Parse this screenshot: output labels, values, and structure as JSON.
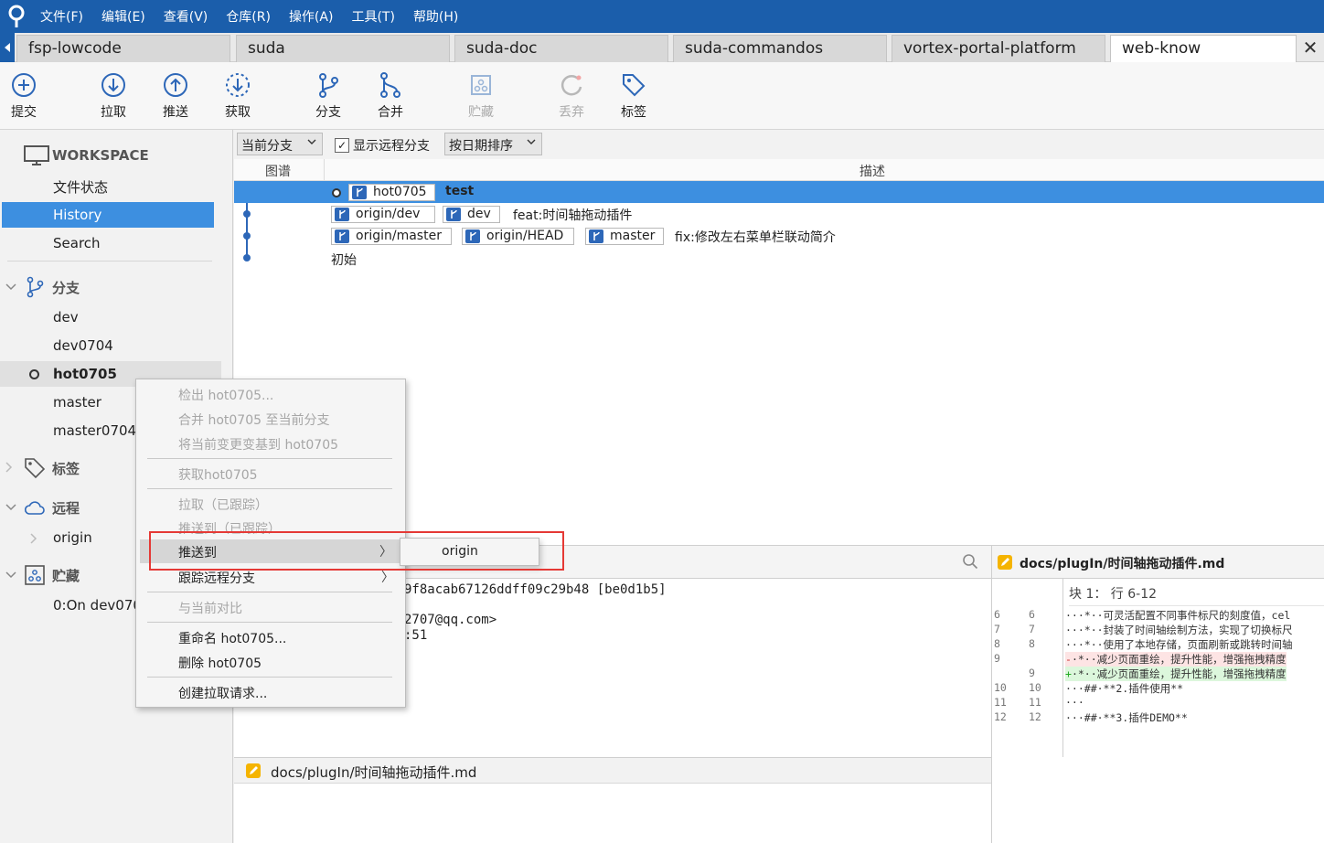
{
  "menu": [
    "文件(F)",
    "编辑(E)",
    "查看(V)",
    "仓库(R)",
    "操作(A)",
    "工具(T)",
    "帮助(H)"
  ],
  "tabs": [
    "fsp-lowcode",
    "suda",
    "suda-doc",
    "suda-commandos",
    "vortex-portal-platform",
    "web-know"
  ],
  "tab_close": "✕",
  "toolbar": {
    "commit": "提交",
    "pull": "拉取",
    "push": "推送",
    "fetch": "获取",
    "branch": "分支",
    "merge": "合并",
    "stash": "贮藏",
    "discard": "丢弃",
    "tag": "标签"
  },
  "sidebar": {
    "workspace": "WORKSPACE",
    "file_status": "文件状态",
    "history": "History",
    "search": "Search",
    "branches_label": "分支",
    "branches": [
      "dev",
      "dev0704",
      "hot0705",
      "master",
      "master0704"
    ],
    "tags_label": "标签",
    "remotes_label": "远程",
    "remotes": [
      "origin"
    ],
    "stashes_label": "贮藏",
    "stashes": [
      "0:On dev070"
    ]
  },
  "filter": {
    "branch_mode": "当前分支",
    "show_remote": "显示远程分支",
    "show_remote_checked": "✓",
    "sort": "按日期排序"
  },
  "grid_header": {
    "graph": "图谱",
    "description": "描述"
  },
  "commits": [
    {
      "badges": [
        "hot0705"
      ],
      "message": "test"
    },
    {
      "badges": [
        "origin/dev",
        "dev"
      ],
      "message": "feat:时间轴拖动插件"
    },
    {
      "badges": [
        "origin/master",
        "origin/HEAD",
        "master"
      ],
      "message": "fix:修改左右菜单栏联动简介"
    },
    {
      "badges": [],
      "message": "初始"
    }
  ],
  "details": {
    "hash": "9f8acab67126ddff09c29b48 [be0d1b5]",
    "email": "2707@qq.com>",
    "time": ":51"
  },
  "filelist": {
    "file": "docs/plugIn/时间轴拖动插件.md"
  },
  "diff": {
    "title": "docs/plugIn/时间轴拖动插件.md",
    "hunk": "块 1： 行 6-12",
    "lines": [
      {
        "n1": "6",
        "n2": "6",
        "type": "ctx",
        "sign": "",
        "text": "···*··可灵活配置不同事件标尺的刻度值，cel"
      },
      {
        "n1": "7",
        "n2": "7",
        "type": "ctx",
        "sign": "",
        "text": "···*··封装了时间轴绘制方法，实现了切换标尺"
      },
      {
        "n1": "8",
        "n2": "8",
        "type": "ctx",
        "sign": "",
        "text": "···*··使用了本地存储，页面刷新或跳转时间轴"
      },
      {
        "n1": "9",
        "n2": "",
        "type": "del",
        "sign": "-",
        "text": "·*··减少页面重绘，提升性能，增强拖拽精度"
      },
      {
        "n1": "",
        "n2": "9",
        "type": "add",
        "sign": "+",
        "text": "·*··减少页面重绘，提升性能，增强拖拽精度"
      },
      {
        "n1": "10",
        "n2": "10",
        "type": "ctx",
        "sign": "",
        "text": "···##·**2.插件使用**"
      },
      {
        "n1": "11",
        "n2": "11",
        "type": "ctx",
        "sign": "",
        "text": "···"
      },
      {
        "n1": "12",
        "n2": "12",
        "type": "ctx",
        "sign": "",
        "text": "···##·**3.插件DEMO**"
      }
    ]
  },
  "context_menu": {
    "items": [
      {
        "label": "检出 hot0705...",
        "disabled": true
      },
      {
        "label": "合并 hot0705 至当前分支",
        "disabled": true
      },
      {
        "label": "将当前变更变基到 hot0705",
        "disabled": true
      },
      {
        "label": "获取hot0705",
        "disabled": true
      },
      {
        "label": "拉取（已跟踪）",
        "disabled": true
      },
      {
        "label": "推送到（已跟踪）",
        "disabled": true
      },
      {
        "label": "推送到",
        "disabled": false,
        "submenu": true
      },
      {
        "label": "跟踪远程分支",
        "disabled": false,
        "submenu": true
      },
      {
        "label": "与当前对比",
        "disabled": true
      },
      {
        "label": "重命名 hot0705...",
        "disabled": false
      },
      {
        "label": "删除 hot0705",
        "disabled": false
      },
      {
        "label": "创建拉取请求...",
        "disabled": false
      }
    ],
    "submenu_arrow": "〉",
    "submenu_item": "origin"
  },
  "colors": {
    "accent": "#1b5eab",
    "selection": "#3d8fe0",
    "highlight": "#e53935"
  }
}
